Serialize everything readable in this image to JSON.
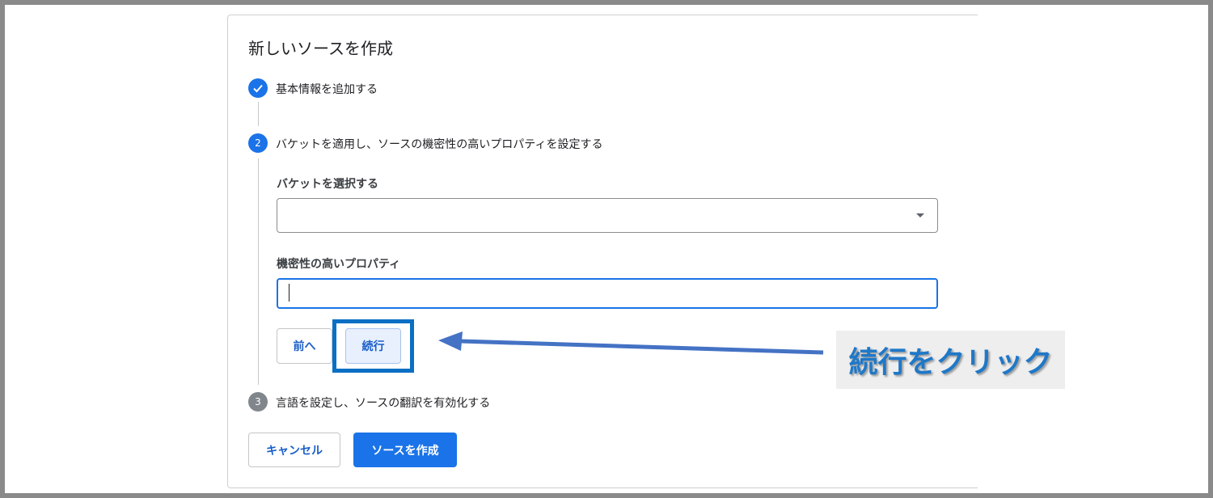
{
  "dialog": {
    "title": "新しいソースを作成"
  },
  "steps": [
    {
      "number": "✓",
      "label": "基本情報を追加する",
      "state": "done"
    },
    {
      "number": "2",
      "label": "バケットを適用し、ソースの機密性の高いプロパティを設定する",
      "state": "active"
    },
    {
      "number": "3",
      "label": "言語を設定し、ソースの翻訳を有効化する",
      "state": "todo"
    }
  ],
  "form": {
    "bucket_label": "バケットを選択する",
    "bucket_value": "",
    "sensitive_label": "機密性の高いプロパティ",
    "sensitive_value": ""
  },
  "buttons": {
    "back": "前へ",
    "continue": "続行",
    "cancel": "キャンセル",
    "create": "ソースを作成"
  },
  "annotation": {
    "text": "続行をクリック"
  },
  "colors": {
    "accent": "#1a73e8",
    "highlight_border": "#0b6fc4",
    "annotation_text": "#1f78c8",
    "arrow": "#4472c4"
  }
}
